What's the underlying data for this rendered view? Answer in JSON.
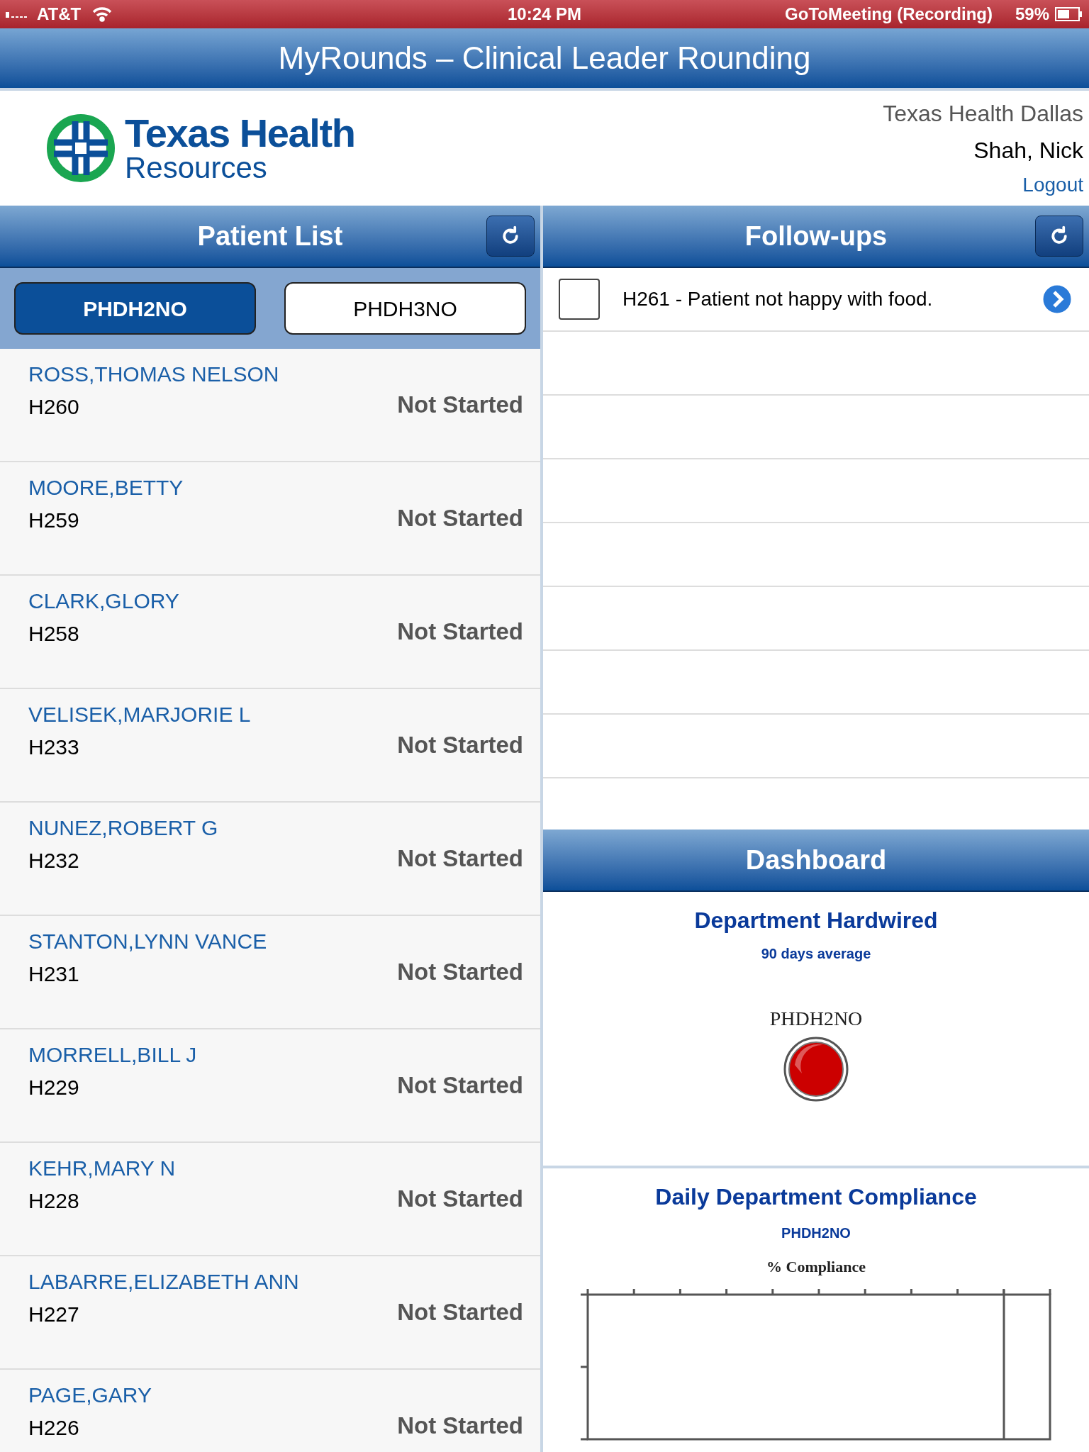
{
  "status_bar": {
    "carrier": "AT&T",
    "time": "10:24 PM",
    "activity": "GoToMeeting (Recording)",
    "battery": "59%"
  },
  "title_bar": {
    "title": "MyRounds – Clinical Leader Rounding"
  },
  "header": {
    "logo_line_1": "Texas Health",
    "logo_line_2": "Resources",
    "facility": "Texas Health Dallas",
    "user": "Shah, Nick",
    "logout": "Logout"
  },
  "patient_list": {
    "title": "Patient List",
    "segments": [
      {
        "label": "PHDH2NO",
        "selected": true
      },
      {
        "label": "PHDH3NO",
        "selected": false
      }
    ],
    "patients": [
      {
        "name": "ROSS,THOMAS NELSON",
        "room": "H260",
        "status": "Not Started"
      },
      {
        "name": "MOORE,BETTY",
        "room": "H259",
        "status": "Not Started"
      },
      {
        "name": "CLARK,GLORY",
        "room": "H258",
        "status": "Not Started"
      },
      {
        "name": "VELISEK,MARJORIE L",
        "room": "H233",
        "status": "Not Started"
      },
      {
        "name": "NUNEZ,ROBERT G",
        "room": "H232",
        "status": "Not Started"
      },
      {
        "name": "STANTON,LYNN VANCE",
        "room": "H231",
        "status": "Not Started"
      },
      {
        "name": "MORRELL,BILL J",
        "room": "H229",
        "status": "Not Started"
      },
      {
        "name": "KEHR,MARY N",
        "room": "H228",
        "status": "Not Started"
      },
      {
        "name": "LABARRE,ELIZABETH ANN",
        "room": "H227",
        "status": "Not Started"
      },
      {
        "name": "PAGE,GARY",
        "room": "H226",
        "status": "Not Started"
      }
    ]
  },
  "follow_ups": {
    "title": "Follow-ups",
    "items": [
      {
        "text": "H261 - Patient not happy with food.",
        "checked": false
      }
    ]
  },
  "dashboard": {
    "title": "Dashboard",
    "hardwired": {
      "title": "Department Hardwired",
      "subtitle": "90 days average",
      "unit": "PHDH2NO"
    },
    "compliance": {
      "title": "Daily Department Compliance",
      "unit": "PHDH2NO",
      "chart_title": "% Compliance"
    }
  }
}
